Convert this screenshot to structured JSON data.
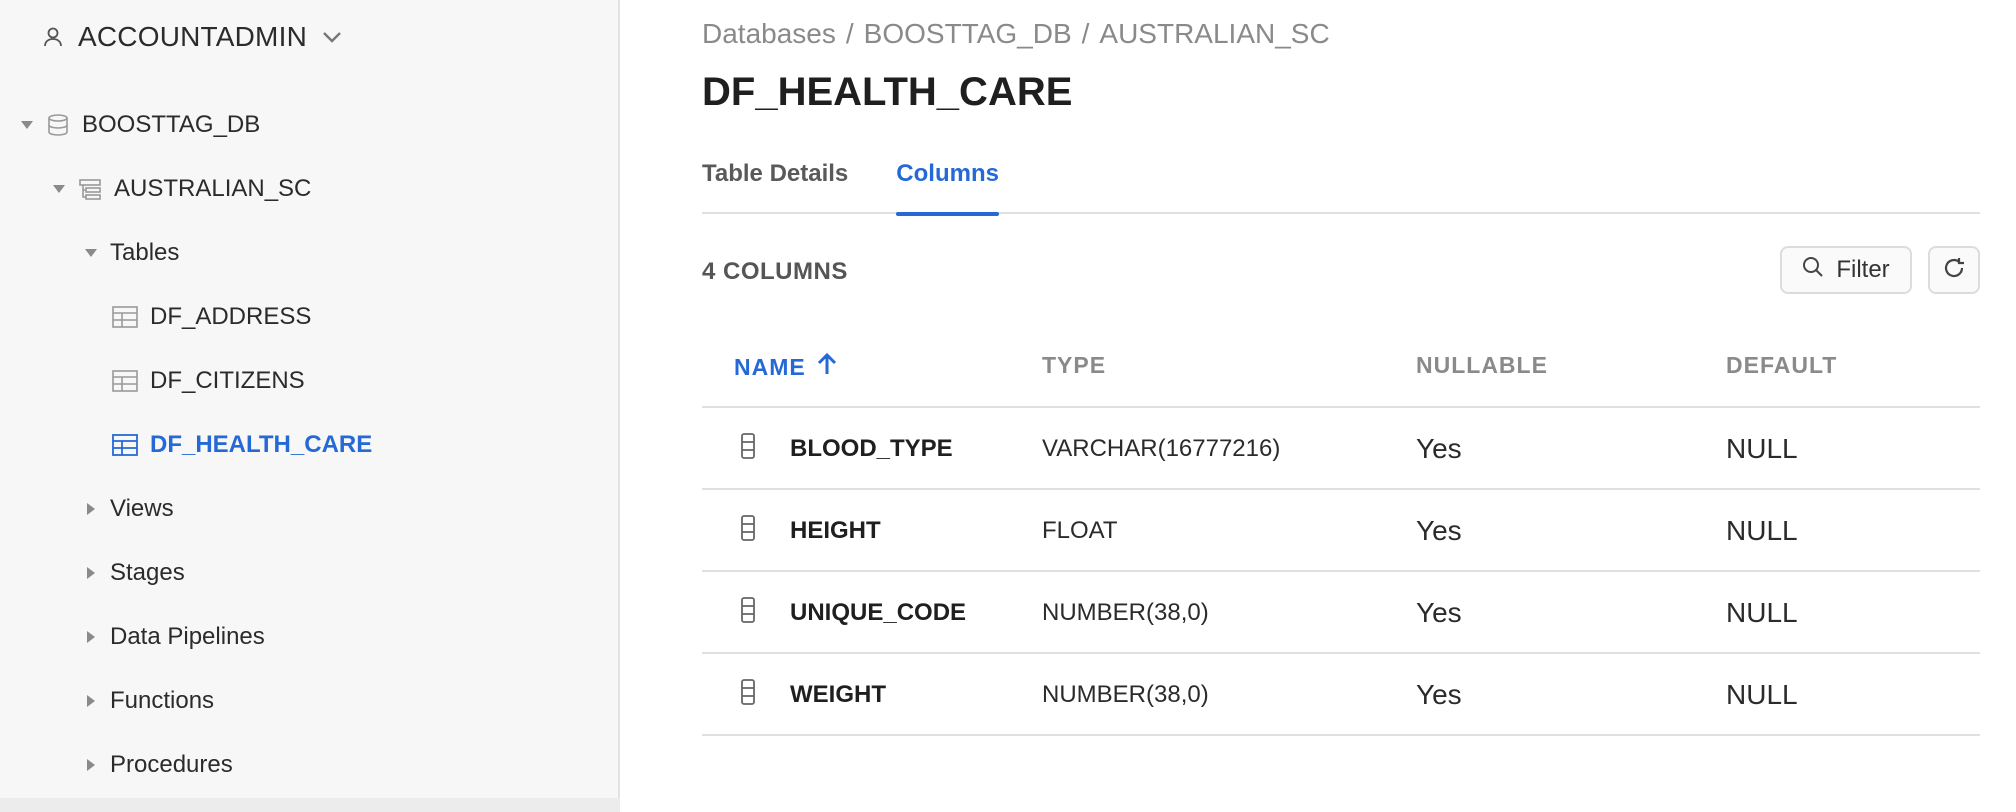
{
  "sidebar": {
    "role": "ACCOUNTADMIN",
    "tree": {
      "database": "BOOSTTAG_DB",
      "schema": "AUSTRALIAN_SC",
      "tables_label": "Tables",
      "tables": [
        "DF_ADDRESS",
        "DF_CITIZENS",
        "DF_HEALTH_CARE"
      ],
      "views_label": "Views",
      "stages_label": "Stages",
      "pipelines_label": "Data Pipelines",
      "functions_label": "Functions",
      "procedures_label": "Procedures"
    }
  },
  "breadcrumb": {
    "items": [
      "Databases",
      "BOOSTTAG_DB",
      "AUSTRALIAN_SC"
    ],
    "separator": "/"
  },
  "page_title": "DF_HEALTH_CARE",
  "tabs": [
    {
      "label": "Table Details",
      "active": false
    },
    {
      "label": "Columns",
      "active": true
    }
  ],
  "columns_count": "4 COLUMNS",
  "filter_label": "Filter",
  "table": {
    "headers": {
      "name": "NAME",
      "type": "TYPE",
      "nullable": "NULLABLE",
      "default": "DEFAULT"
    },
    "rows": [
      {
        "name": "BLOOD_TYPE",
        "type": "VARCHAR(16777216)",
        "nullable": "Yes",
        "default": "NULL"
      },
      {
        "name": "HEIGHT",
        "type": "FLOAT",
        "nullable": "Yes",
        "default": "NULL"
      },
      {
        "name": "UNIQUE_CODE",
        "type": "NUMBER(38,0)",
        "nullable": "Yes",
        "default": "NULL"
      },
      {
        "name": "WEIGHT",
        "type": "NUMBER(38,0)",
        "nullable": "Yes",
        "default": "NULL"
      }
    ]
  },
  "icons": {
    "role": "user-icon",
    "database": "database-icon",
    "schema": "schema-icon",
    "table": "table-icon",
    "column": "column-icon",
    "search": "search-icon",
    "refresh": "refresh-icon",
    "sort": "arrow-up-icon"
  },
  "colors": {
    "accent": "#2569d6",
    "sidebar_bg": "#f7f7f7",
    "muted_text": "#8a8a8a"
  }
}
